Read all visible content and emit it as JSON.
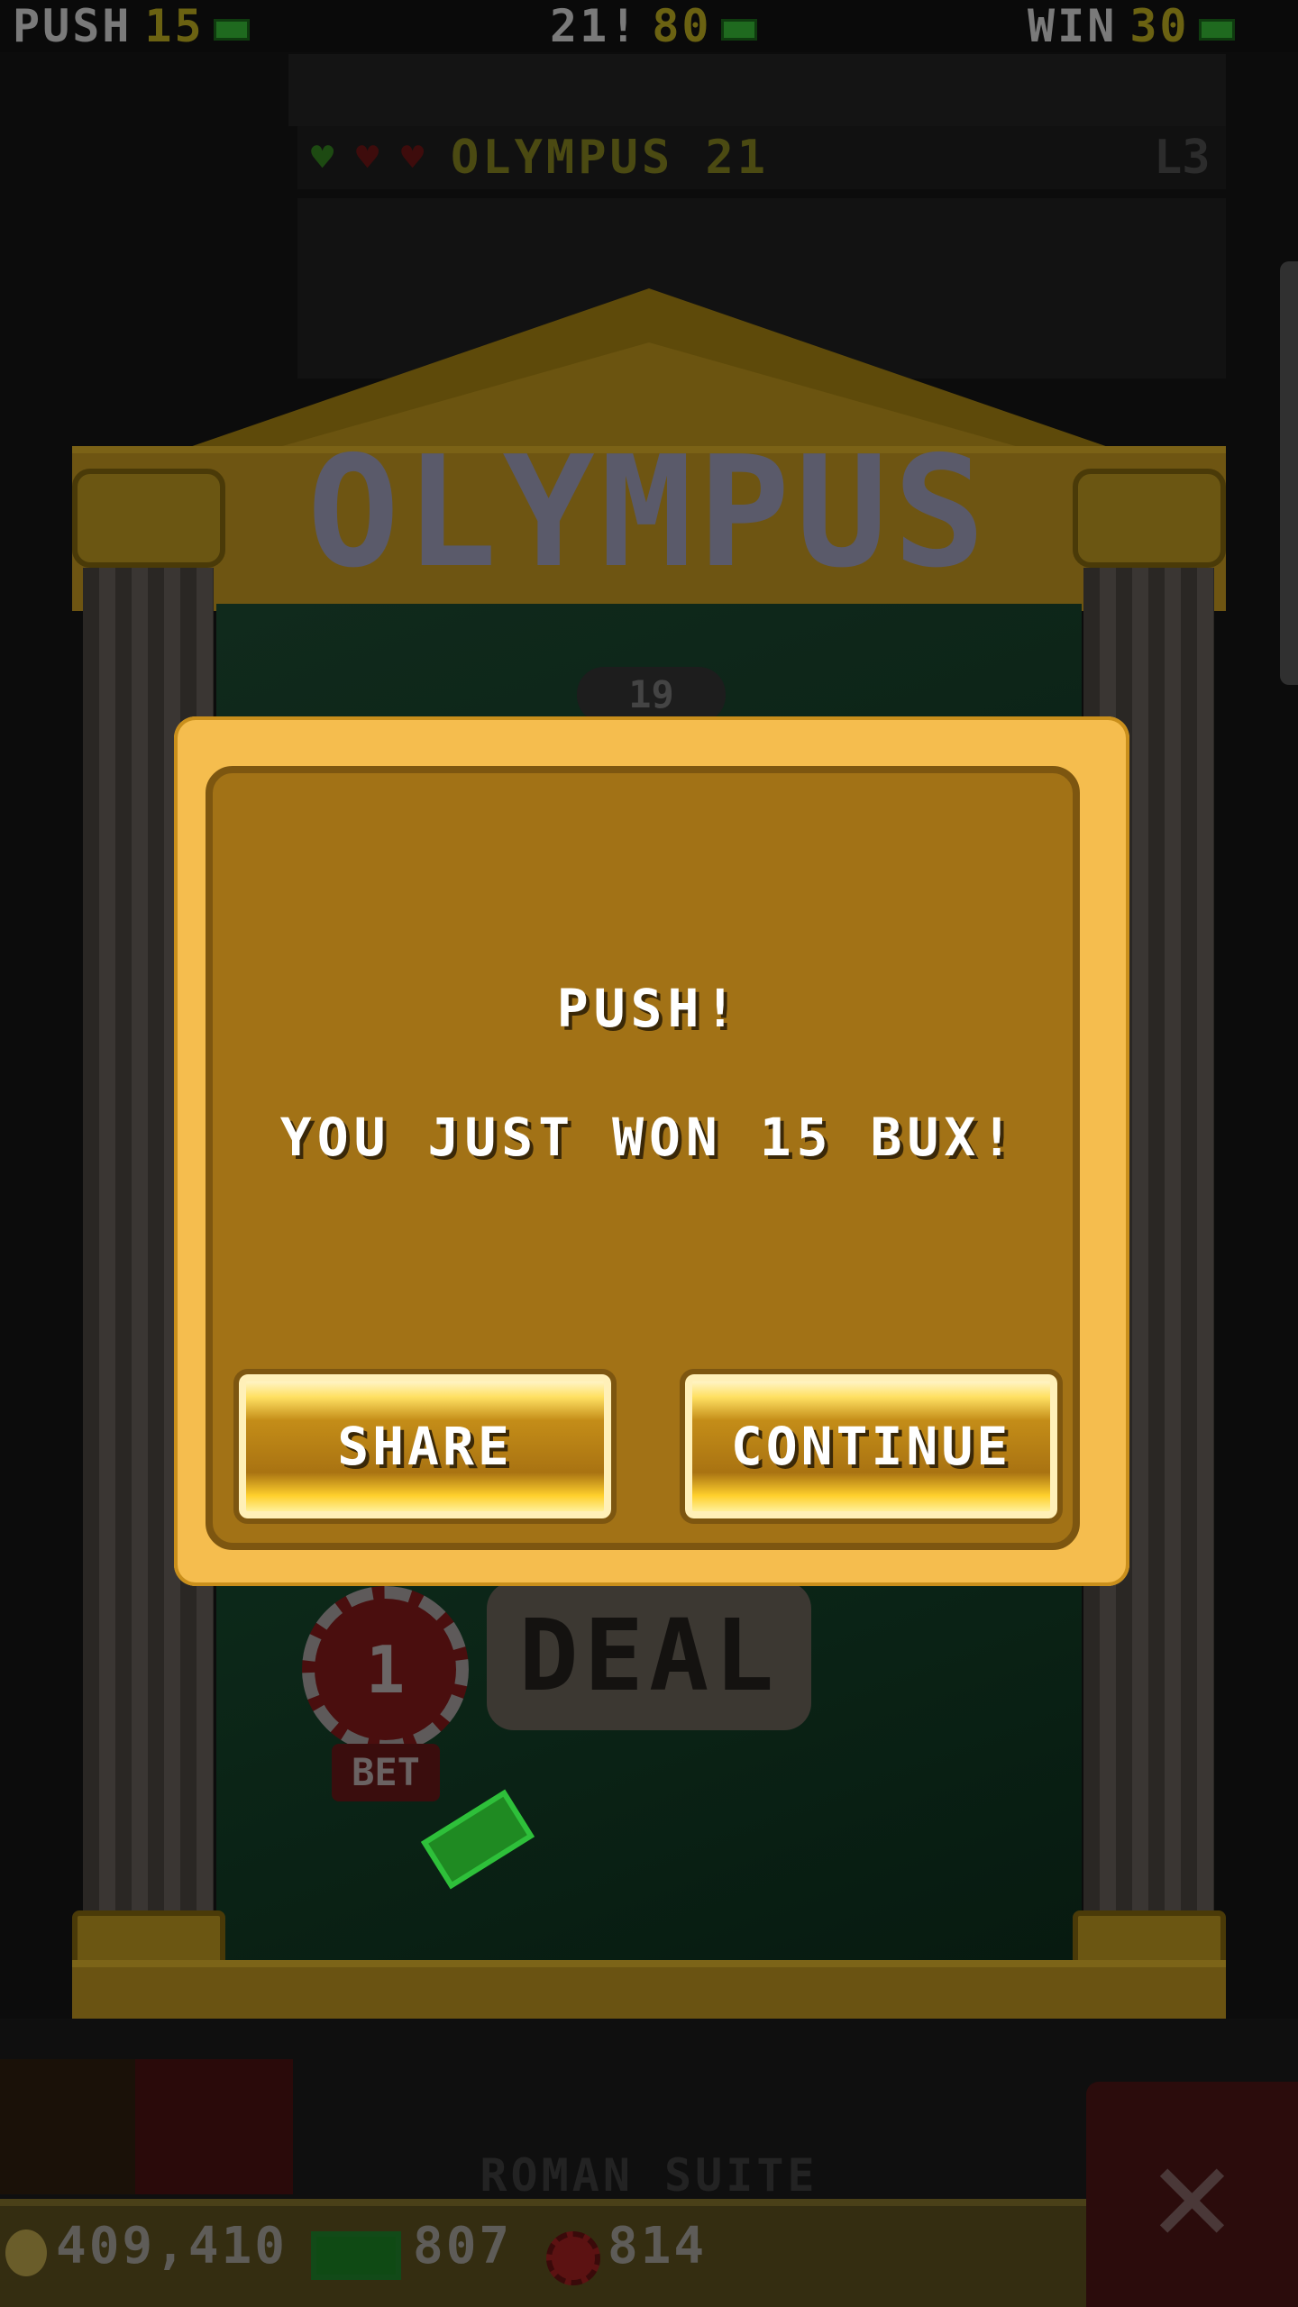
{
  "top_bar": {
    "push_label": "PUSH",
    "push_value": "15",
    "bj_label": "21!",
    "bj_value": "80",
    "win_label": "WIN",
    "win_value": "30"
  },
  "table": {
    "title": "OLYMPUS 21",
    "level": "L3",
    "temple_name": "OLYMPUS",
    "score": "19",
    "chip_value": "1",
    "bet_label": "BET",
    "deal_label": "DEAL",
    "suite_name": "ROMAN SUITE"
  },
  "wallet": {
    "coins": "409,410",
    "bux": "807",
    "chips": "814"
  },
  "dialog": {
    "title": "PUSH!",
    "message": "YOU JUST WON 15 BUX!",
    "share_label": "SHARE",
    "continue_label": "CONTINUE"
  },
  "icons": [
    "cash-icon",
    "coin-icon",
    "chip-icon",
    "close-icon",
    "heart-icon"
  ],
  "colors": {
    "dialog_outer": "#f5bd4e",
    "dialog_inner": "#a27216",
    "payout_value": "#6b6212"
  }
}
